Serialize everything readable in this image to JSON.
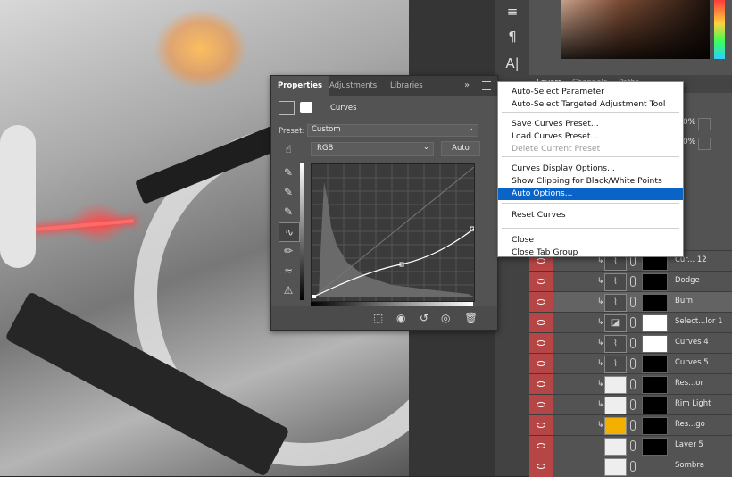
{
  "properties": {
    "tabs": [
      "Properties",
      "Adjustments",
      "Libraries"
    ],
    "panel_icons": "»",
    "adjustment_title": "Curves",
    "preset_label": "Preset:",
    "preset_value": "Custom",
    "channel_value": "RGB",
    "auto_label": "Auto"
  },
  "menu": {
    "items": [
      {
        "label": "Auto-Select Parameter",
        "state": "normal"
      },
      {
        "label": "Auto-Select Targeted Adjustment Tool",
        "state": "normal"
      },
      {
        "label": "Save Curves Preset...",
        "state": "normal"
      },
      {
        "label": "Load Curves Preset...",
        "state": "normal"
      },
      {
        "label": "Delete Current Preset",
        "state": "disabled"
      },
      {
        "label": "Curves Display Options...",
        "state": "normal"
      },
      {
        "label": "Show Clipping for Black/White Points",
        "state": "normal"
      },
      {
        "label": "Auto Options...",
        "state": "highlighted"
      },
      {
        "label": "Reset Curves",
        "state": "normal"
      },
      {
        "label": "Close",
        "state": "normal"
      },
      {
        "label": "Close Tab Group",
        "state": "normal"
      }
    ]
  },
  "layers_panel": {
    "tabs": [
      "Layers",
      "Channels",
      "Paths"
    ],
    "opacity_value": "0%",
    "fill_value": "0%"
  },
  "layers": [
    {
      "name": "Cur... 12",
      "type": "curves",
      "mask": "black",
      "selected": false
    },
    {
      "name": "Dodge",
      "type": "curves",
      "mask": "black",
      "selected": false
    },
    {
      "name": "Burn",
      "type": "curves",
      "mask": "black",
      "selected": true
    },
    {
      "name": "Select...lor 1",
      "type": "selective-color",
      "mask": "white",
      "selected": false
    },
    {
      "name": "Curves 4",
      "type": "curves",
      "mask": "white",
      "selected": false
    },
    {
      "name": "Curves 5",
      "type": "curves",
      "mask": "black",
      "selected": false
    },
    {
      "name": "Res...or",
      "type": "pixel",
      "mask": "black",
      "selected": false
    },
    {
      "name": "Rim Light",
      "type": "pixel",
      "mask": "black",
      "selected": false
    },
    {
      "name": "Res...go",
      "type": "pixel",
      "mask": "black",
      "selected": false
    },
    {
      "name": "Layer 5",
      "type": "pixel",
      "mask": "black",
      "selected": false
    },
    {
      "name": "Sombra",
      "type": "pixel",
      "mask": "none",
      "selected": false
    }
  ],
  "colors": {
    "menu_highlight": "#0a64c8",
    "eye_column": "#b64646",
    "panel_bg": "#535353"
  }
}
